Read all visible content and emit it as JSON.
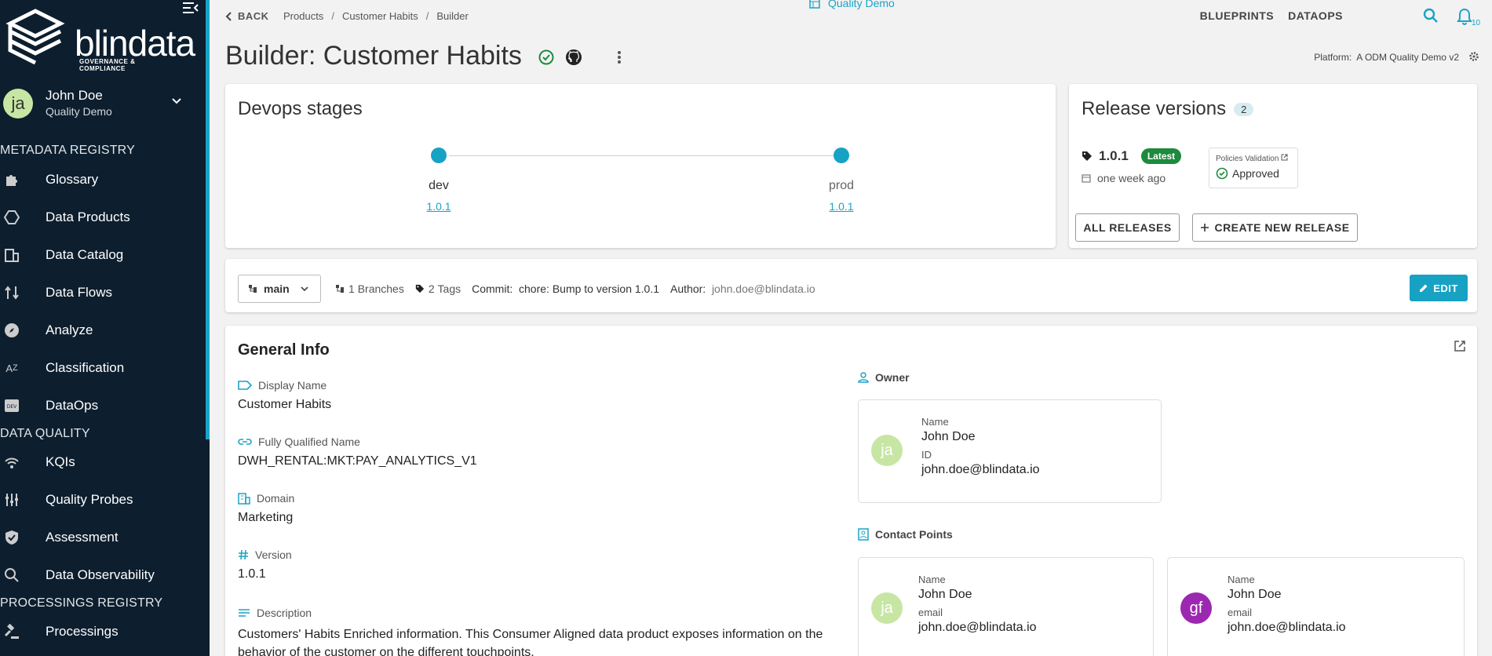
{
  "sidebar": {
    "logo_text": "blindata",
    "logo_subtitle": "GOVERNANCE & COMPLIANCE",
    "user": {
      "initials": "ja",
      "name": "John Doe",
      "org": "Quality Demo"
    },
    "sections": {
      "metadata": "METADATA REGISTRY",
      "quality": "DATA QUALITY",
      "processings": "PROCESSINGS REGISTRY"
    },
    "items": [
      {
        "label": "Glossary",
        "icon": "puzzle-icon"
      },
      {
        "label": "Data Products",
        "icon": "hexagon-icon"
      },
      {
        "label": "Data Catalog",
        "icon": "building-icon"
      },
      {
        "label": "Data Flows",
        "icon": "flow-icon"
      },
      {
        "label": "Analyze",
        "icon": "compass-icon"
      },
      {
        "label": "Classification",
        "icon": "sort-az-icon"
      },
      {
        "label": "DataOps",
        "icon": "dev-icon"
      },
      {
        "label": "KQIs",
        "icon": "signal-icon"
      },
      {
        "label": "Quality Probes",
        "icon": "probe-icon"
      },
      {
        "label": "Assessment",
        "icon": "shield-icon"
      },
      {
        "label": "Data Observability",
        "icon": "observe-icon"
      },
      {
        "label": "Processings",
        "icon": "gavel-icon"
      }
    ]
  },
  "topbar": {
    "back": "BACK",
    "breadcrumbs": [
      "Products",
      "Customer Habits",
      "Builder"
    ],
    "tenant": "Quality Demo",
    "nav": [
      "BLUEPRINTS",
      "DATAOPS"
    ],
    "notifications": "10"
  },
  "page": {
    "title": "Builder: Customer Habits",
    "platform_label": "Platform:",
    "platform_value": "A ODM Quality Demo v2"
  },
  "devops": {
    "title": "Devops stages",
    "stages": [
      {
        "name": "dev",
        "version": "1.0.1"
      },
      {
        "name": "prod",
        "version": "1.0.1"
      }
    ]
  },
  "releases": {
    "title": "Release versions",
    "count": "2",
    "version": "1.0.1",
    "latest_badge": "Latest",
    "date": "one week ago",
    "policy_title": "Policies Validation",
    "policy_status": "Approved",
    "all_releases": "ALL RELEASES",
    "create_release": "CREATE NEW RELEASE"
  },
  "git": {
    "branch": "main",
    "branches_count": "1",
    "branches_label": "Branches",
    "tags_count": "2",
    "tags_label": "Tags",
    "commit_label": "Commit:",
    "commit_value": "chore: Bump to version 1.0.1",
    "author_label": "Author:",
    "author_value": "john.doe@blindata.io",
    "edit": "EDIT"
  },
  "general_info": {
    "title": "General Info",
    "display_name_label": "Display Name",
    "display_name": "Customer Habits",
    "fqn_label": "Fully Qualified Name",
    "fqn": "DWH_RENTAL:MKT:PAY_ANALYTICS_V1",
    "domain_label": "Domain",
    "domain": "Marketing",
    "version_label": "Version",
    "version": "1.0.1",
    "description_label": "Description",
    "description": "Customers' Habits Enriched information. This Consumer Aligned data product exposes information on the behavior of the customer on the different touchpoints.",
    "owner_label": "Owner",
    "owner": {
      "initials": "ja",
      "name_label": "Name",
      "name": "John Doe",
      "id_label": "ID",
      "id": "john.doe@blindata.io"
    },
    "contacts_label": "Contact Points",
    "contacts": [
      {
        "initials": "ja",
        "name_label": "Name",
        "name": "John Doe",
        "email_label": "email",
        "email": "john.doe@blindata.io",
        "color": "#c7e6a4"
      },
      {
        "initials": "gf",
        "name_label": "Name",
        "name": "John Doe",
        "email_label": "email",
        "email": "john.doe@blindata.io",
        "color": "#9c27b0"
      }
    ]
  }
}
